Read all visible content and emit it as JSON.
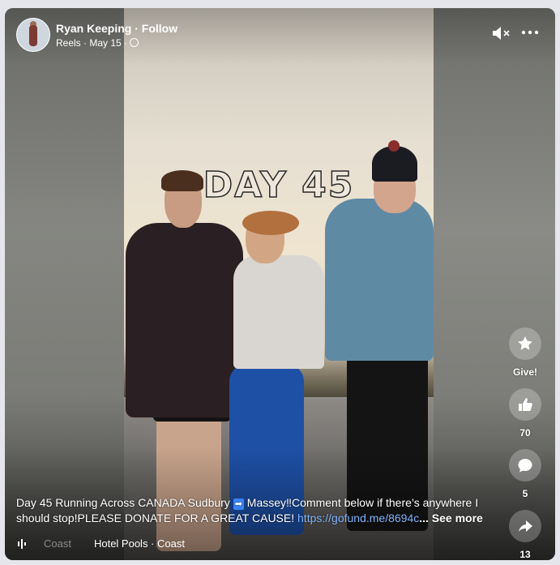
{
  "header": {
    "author": "Ryan Keeping",
    "follow_label": "Follow",
    "author_line": "Ryan Keeping · Follow",
    "meta": "Reels · May 15 ·"
  },
  "video": {
    "overlay_text": "DAY 45"
  },
  "actions": {
    "give_label": "Give!",
    "likes": "70",
    "comments": "5",
    "shares": "13"
  },
  "caption": {
    "text_a": "Day 45 Running Across CANADA Sudbury ",
    "arrow": "➡",
    "text_b": " Massey‼Comment below if there’s anywhere I should stop!PLEASE DONATE FOR A GREAT CAUSE! ",
    "link": "https://gofund.me/8694c",
    "see_more": "... See more"
  },
  "audio": {
    "faded_title": "Coast",
    "title": "Hotel Pools · Coast"
  },
  "icons": [
    "audio-muted-icon",
    "more-options-icon",
    "give-star-icon",
    "like-thumb-icon",
    "comment-bubble-icon",
    "share-arrow-icon",
    "globe-icon",
    "audio-waveform-icon"
  ]
}
